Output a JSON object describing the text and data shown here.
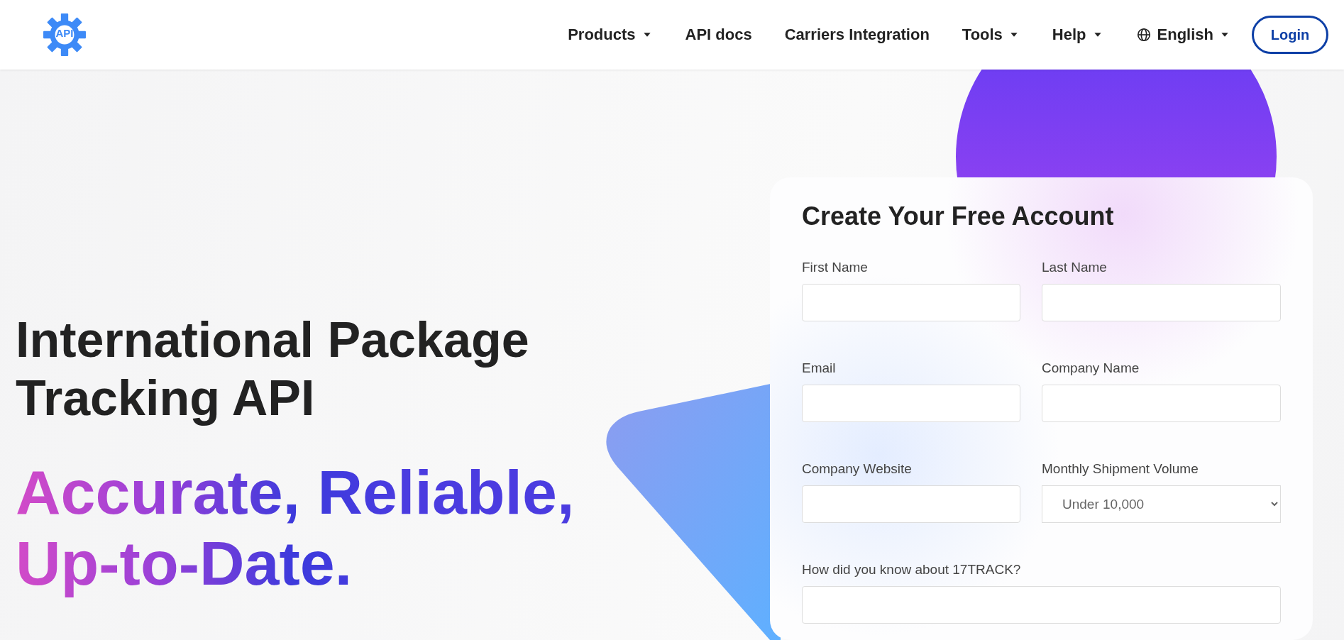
{
  "header": {
    "logo": {
      "text": "API"
    },
    "nav": [
      {
        "label": "Products",
        "kind": "menu",
        "dropdown": true
      },
      {
        "label": "API docs",
        "kind": "link",
        "dropdown": false
      },
      {
        "label": "Carriers Integration",
        "kind": "link",
        "dropdown": false
      },
      {
        "label": "Tools",
        "kind": "menu",
        "dropdown": true
      },
      {
        "label": "Help",
        "kind": "menu",
        "dropdown": true
      },
      {
        "label": "English",
        "kind": "language",
        "dropdown": true
      }
    ],
    "login_button": "Login"
  },
  "hero": {
    "headline": [
      "International Package",
      "Tracking API"
    ],
    "tagline": [
      "Accurate, Reliable,",
      "Up-to-Date."
    ]
  },
  "signup_form": {
    "title": "Create Your Free Account",
    "rows": [
      [
        {
          "label": "First Name",
          "kind": "text"
        },
        {
          "label": "Last Name",
          "kind": "text"
        }
      ],
      [
        {
          "label": "Email",
          "kind": "text"
        },
        {
          "label": "Company Name",
          "kind": "text"
        }
      ],
      [
        {
          "label": "Company Website",
          "kind": "text"
        },
        {
          "label": "Monthly Shipment Volume",
          "kind": "select",
          "value": "Under 10,000"
        }
      ],
      [
        {
          "label": "How did you know about 17TRACK?",
          "kind": "text"
        }
      ]
    ]
  }
}
